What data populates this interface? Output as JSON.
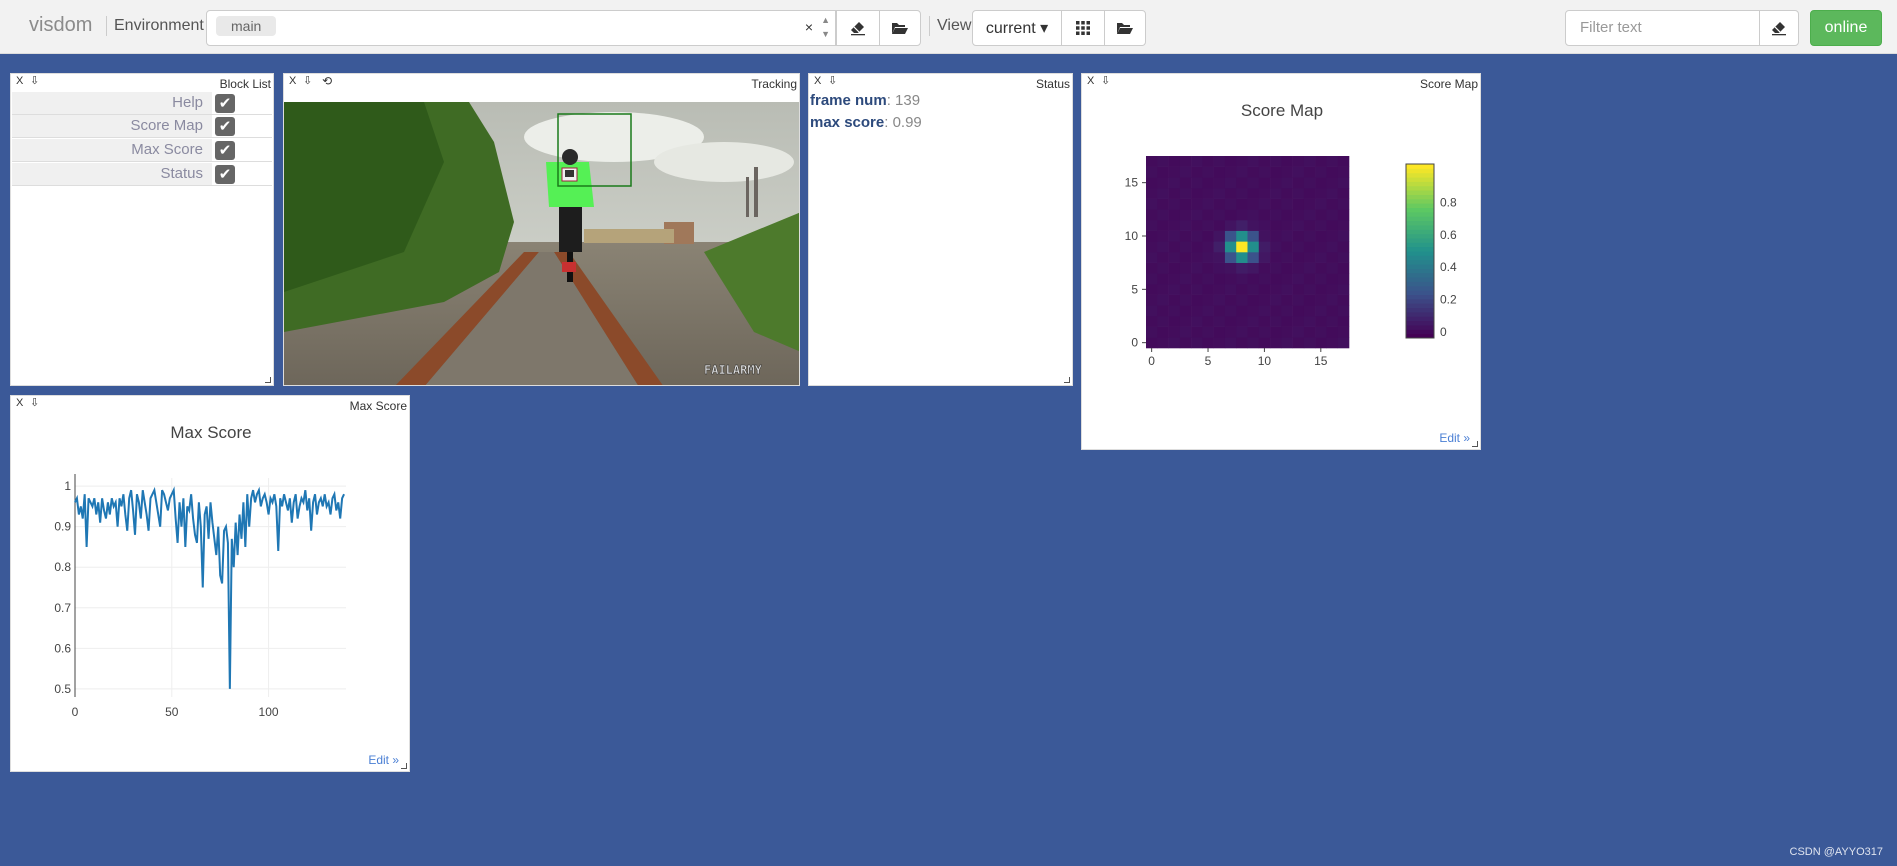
{
  "app": {
    "brand": "visdom"
  },
  "env": {
    "label": "Environment",
    "chip": "main",
    "clear": "×"
  },
  "view": {
    "label": "View",
    "current": "current ▾"
  },
  "filter": {
    "placeholder": "Filter text"
  },
  "status_button": "online",
  "panes": {
    "blocklist": {
      "title": "Block List",
      "items": [
        {
          "label": "Help",
          "checked": true
        },
        {
          "label": "Score Map",
          "checked": true
        },
        {
          "label": "Max Score",
          "checked": true
        },
        {
          "label": "Status",
          "checked": true
        }
      ]
    },
    "tracking": {
      "title": "Tracking",
      "watermark": "FAILARMY"
    },
    "status": {
      "title": "Status",
      "frame_key": "frame num",
      "frame_val": "139",
      "score_key": "max score",
      "score_val": "0.99"
    },
    "scoremap": {
      "title": "Score Map",
      "edit": "Edit »"
    },
    "maxscore": {
      "title": "Max Score",
      "edit": "Edit »"
    }
  },
  "credit": "CSDN @AYYO317",
  "icons": [
    "close-icon",
    "download-icon",
    "refresh-icon",
    "eraser-icon",
    "folder-open-icon",
    "grid-icon",
    "checkmark-icon"
  ],
  "colors": {
    "background": "#3b5998",
    "online": "#5cb85c",
    "line": "#1f77b4",
    "bbox": "#1a7a1a"
  },
  "chart_data": [
    {
      "type": "heatmap",
      "title": "Score Map",
      "x_ticks": [
        "0",
        "5",
        "10",
        "15"
      ],
      "y_ticks": [
        "0",
        "5",
        "10",
        "15"
      ],
      "grid_size": [
        18,
        18
      ],
      "peak": {
        "x": 8,
        "y": 9,
        "value": 0.99
      },
      "colorbar_ticks": [
        "0",
        "0.2",
        "0.4",
        "0.6",
        "0.8"
      ],
      "colorscale": "viridis",
      "zlim": [
        0,
        1
      ]
    },
    {
      "type": "line",
      "title": "Max Score",
      "xlim": [
        0,
        140
      ],
      "ylim": [
        0.48,
        1.02
      ],
      "x_ticks": [
        "0",
        "50",
        "100"
      ],
      "y_ticks": [
        "0.5",
        "0.6",
        "0.7",
        "0.8",
        "0.9",
        "1"
      ],
      "x_tick_values": [
        0,
        50,
        100
      ],
      "y_tick_values": [
        0.5,
        0.6,
        0.7,
        0.8,
        0.9,
        1
      ],
      "series": [
        {
          "values": [
            0.96,
            0.97,
            0.93,
            0.95,
            0.92,
            0.98,
            0.85,
            0.97,
            0.96,
            0.95,
            0.97,
            0.93,
            0.96,
            0.91,
            0.97,
            0.94,
            0.92,
            0.96,
            0.93,
            0.97,
            0.95,
            0.96,
            0.9,
            0.97,
            0.95,
            0.98,
            0.93,
            0.89,
            0.97,
            0.99,
            0.94,
            0.88,
            0.98,
            0.96,
            0.92,
            0.99,
            0.96,
            0.93,
            0.89,
            0.97,
            0.98,
            0.99,
            0.96,
            0.93,
            0.9,
            0.99,
            0.98,
            0.96,
            0.94,
            0.97,
            0.98,
            0.99,
            0.92,
            0.86,
            0.96,
            0.9,
            0.97,
            0.85,
            0.95,
            0.94,
            0.98,
            0.92,
            0.88,
            0.86,
            0.96,
            0.9,
            0.75,
            0.93,
            0.95,
            0.87,
            0.96,
            0.91,
            0.87,
            0.83,
            0.9,
            0.78,
            0.76,
            0.89,
            0.9,
            0.86,
            0.5,
            0.87,
            0.8,
            0.91,
            0.83,
            0.93,
            0.87,
            0.96,
            0.85,
            0.98,
            0.9,
            0.97,
            0.99,
            0.96,
            0.98,
            0.99,
            0.95,
            0.97,
            0.98,
            0.96,
            0.93,
            0.97,
            0.96,
            0.98,
            0.95,
            0.84,
            0.97,
            0.95,
            0.98,
            0.96,
            0.94,
            0.97,
            0.91,
            0.96,
            0.98,
            0.92,
            0.95,
            0.97,
            0.96,
            0.99,
            0.94,
            0.97,
            0.89,
            0.96,
            0.98,
            0.93,
            0.96,
            0.97,
            0.95,
            0.98,
            0.95,
            0.96,
            0.93,
            0.97,
            0.98,
            0.94,
            0.96,
            0.92,
            0.97,
            0.98
          ]
        }
      ]
    }
  ]
}
